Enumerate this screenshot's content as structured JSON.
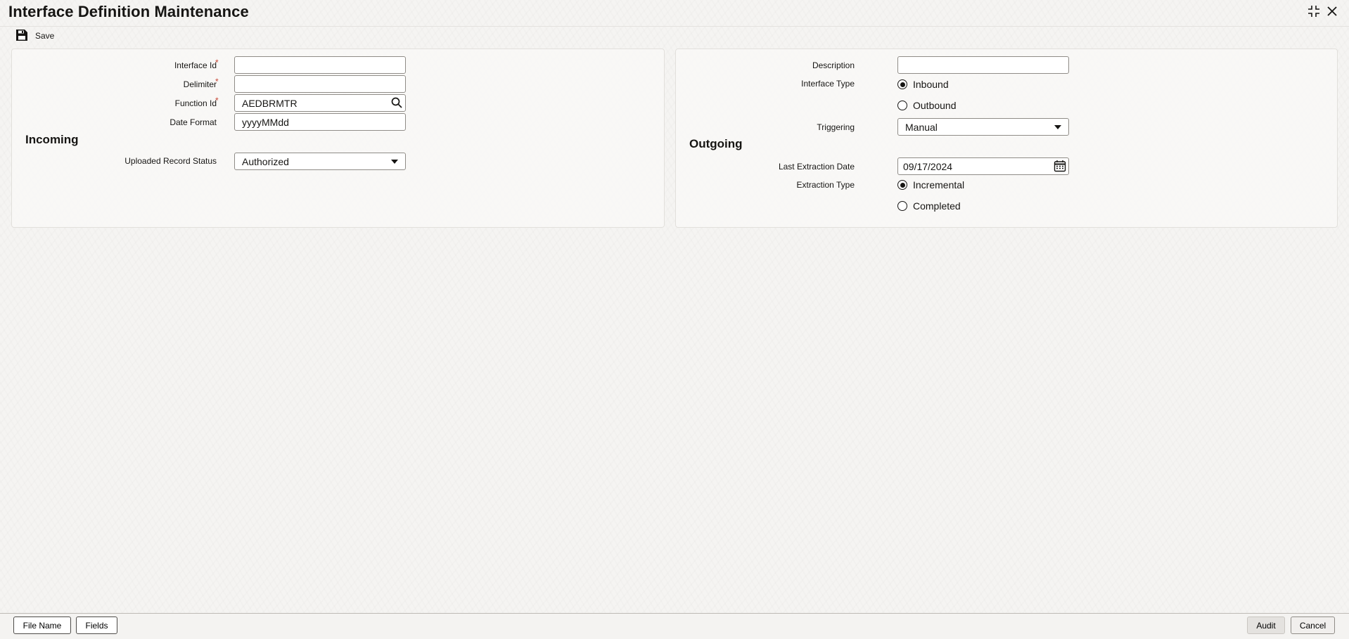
{
  "window": {
    "title": "Interface Definition Maintenance",
    "controls": [
      "expand-icon",
      "close-icon"
    ]
  },
  "toolbar": {
    "save_label": "Save",
    "save_icon": "floppy-disk-icon"
  },
  "left_panel": {
    "interface_id": {
      "label": "Interface Id",
      "value": ""
    },
    "delimiter": {
      "label": "Delimiter",
      "value": ""
    },
    "function_id": {
      "label": "Function Id",
      "value": "AEDBRMTR",
      "icon": "search-icon"
    },
    "date_format": {
      "label": "Date Format",
      "value": "yyyyMMdd"
    },
    "incoming": {
      "title": "Incoming",
      "uploaded_record_status": {
        "label": "Uploaded Record Status",
        "value": "Authorized"
      }
    }
  },
  "right_panel": {
    "description": {
      "label": "Description",
      "value": ""
    },
    "interface_type": {
      "label": "Interface Type",
      "options": [
        "Inbound",
        "Outbound"
      ],
      "selected": "Inbound"
    },
    "triggering": {
      "label": "Triggering",
      "value": "Manual"
    },
    "outgoing": {
      "title": "Outgoing",
      "last_extraction_date": {
        "label": "Last Extraction Date",
        "value": "09/17/2024",
        "icon": "calendar-icon"
      },
      "extraction_type": {
        "label": "Extraction Type",
        "options": [
          "Incremental",
          "Completed"
        ],
        "selected": "Incremental"
      }
    }
  },
  "footer": {
    "file_name_label": "File Name",
    "fields_label": "Fields",
    "audit_label": "Audit",
    "cancel_label": "Cancel"
  },
  "colors": {
    "required": "#c74634",
    "text": "#161513",
    "border": "#8f8c87"
  }
}
